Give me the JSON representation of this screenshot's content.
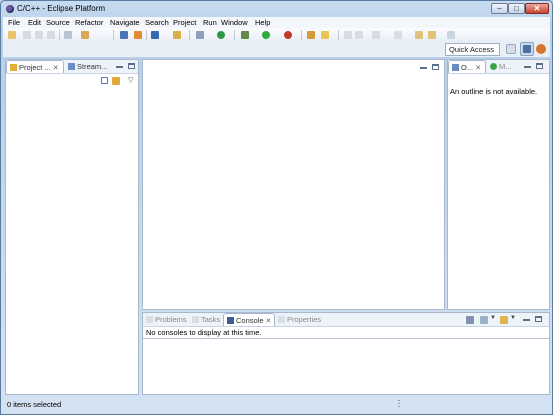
{
  "window": {
    "title": "C/C++ - Eclipse Platform"
  },
  "menu": [
    "File",
    "Edit",
    "Source",
    "Refactor",
    "Navigate",
    "Search",
    "Project",
    "Run",
    "Window",
    "Help"
  ],
  "toolbar": {
    "quick_access_placeholder": "Quick Access"
  },
  "left_panel": {
    "tabs": [
      {
        "label": "Project ...",
        "icon": "project-explorer-icon",
        "active": true
      },
      {
        "label": "Stream...",
        "icon": "make-target-icon",
        "active": false
      }
    ]
  },
  "outline_panel": {
    "tabs": [
      {
        "label": "O...",
        "icon": "outline-icon",
        "active": true
      },
      {
        "label": "M...",
        "icon": "make-icon",
        "active": false
      }
    ],
    "message": "An outline is not available."
  },
  "bottom_panel": {
    "tabs": [
      {
        "label": "Problems",
        "icon": "problems-icon",
        "active": false
      },
      {
        "label": "Tasks",
        "icon": "tasks-icon",
        "active": false
      },
      {
        "label": "Console",
        "icon": "console-icon",
        "active": true
      },
      {
        "label": "Properties",
        "icon": "properties-icon",
        "active": false
      }
    ],
    "message": "No consoles to display at this time."
  },
  "status": {
    "text": "0 items selected"
  },
  "colors": {
    "accent": "#3f72b6",
    "window_frame": "#b9d1ea"
  }
}
